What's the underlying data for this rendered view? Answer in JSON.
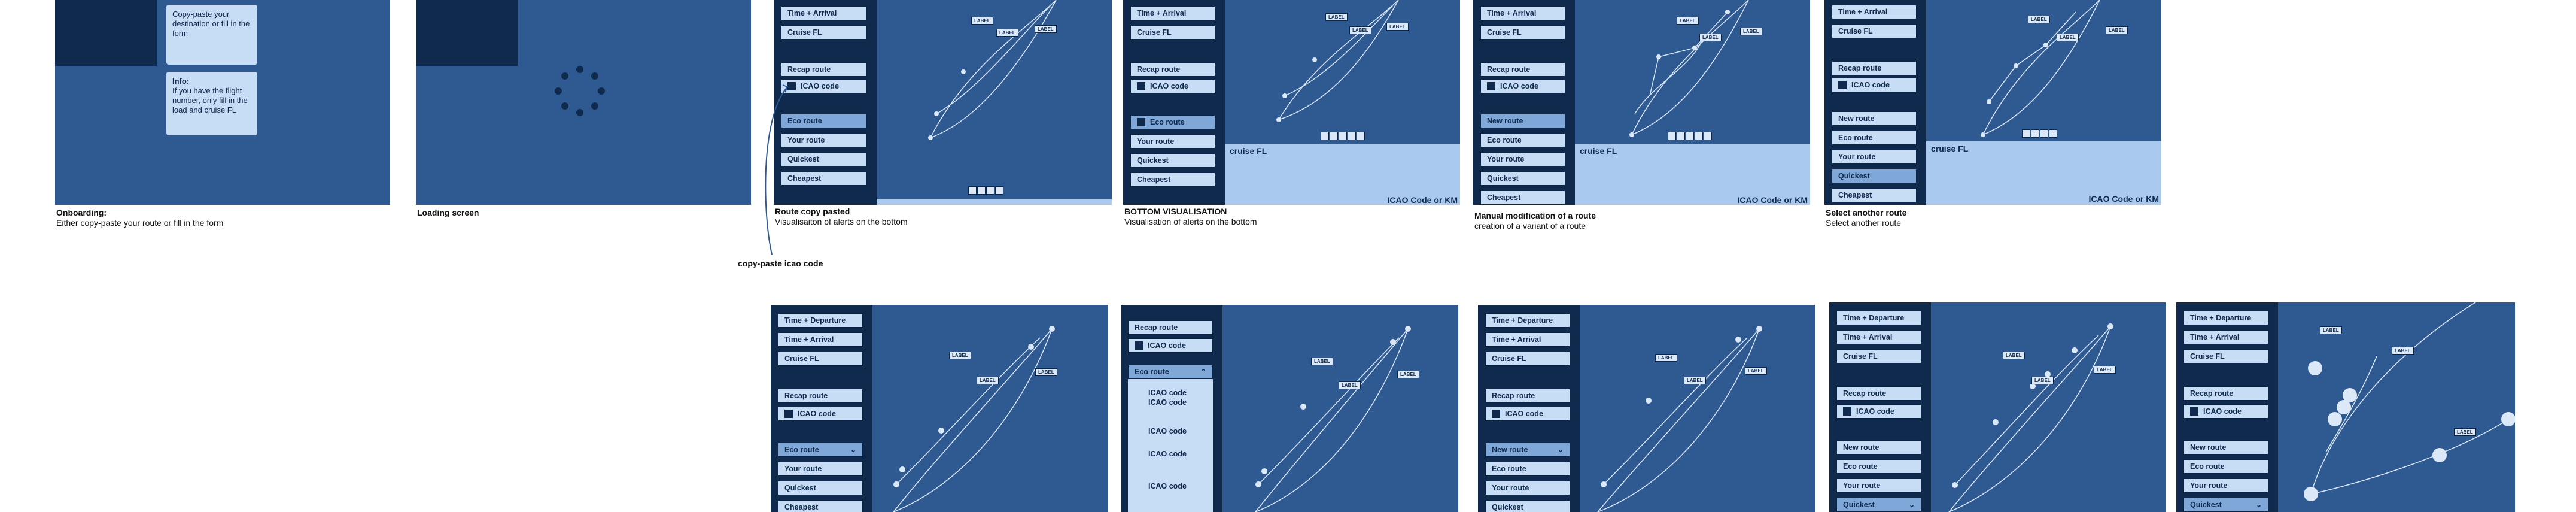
{
  "buttons": {
    "time_departure": "Time + Departure",
    "time_arrival": "Time + Arrival",
    "cruise_fl": "Cruise FL",
    "recap_route": "Recap route",
    "icao_code": "ICAO code",
    "eco_route": "Eco route",
    "your_route": "Your route",
    "quickest": "Quickest",
    "cheapest": "Cheapest",
    "new_route": "New route"
  },
  "map": {
    "label": "LABEL"
  },
  "bottom_panel": {
    "cruise_fl": "cruise FL",
    "icao_km": "ICAO Code or KM"
  },
  "onboarding": {
    "tooltip": "Copy-paste your destination or fill in the form",
    "info_title": "Info:",
    "info_body": "If you have the flight number, only fill in the load and cruise FL"
  },
  "dropdown": {
    "items": [
      "ICAO code",
      "ICAO code",
      "ICAO code",
      "ICAO code",
      "ICAO code"
    ]
  },
  "captions": {
    "onboarding_title": "Onboarding:",
    "onboarding_sub": "Either copy-paste your route or fill in the form",
    "loading_title": "Loading screen",
    "paste_title": "Route copy pasted",
    "paste_sub": "Visualisaiton of alerts on the bottom",
    "bottom_title": "BOTTOM VISUALISATION",
    "bottom_sub": "Visualisation of alerts on the bottom",
    "manual_title": "Manual modification of a route",
    "manual_sub": "creation of a variant of a route",
    "select_title": "Select another route",
    "select_sub": "Select another route",
    "copy_paste_icao": "copy-paste icao code"
  },
  "colors": {
    "frame": "#2e5a91",
    "sidebar": "#0f2a4d",
    "button": "#c7dcf5",
    "selected": "#7fa7d8",
    "panel": "#aac9ee"
  }
}
